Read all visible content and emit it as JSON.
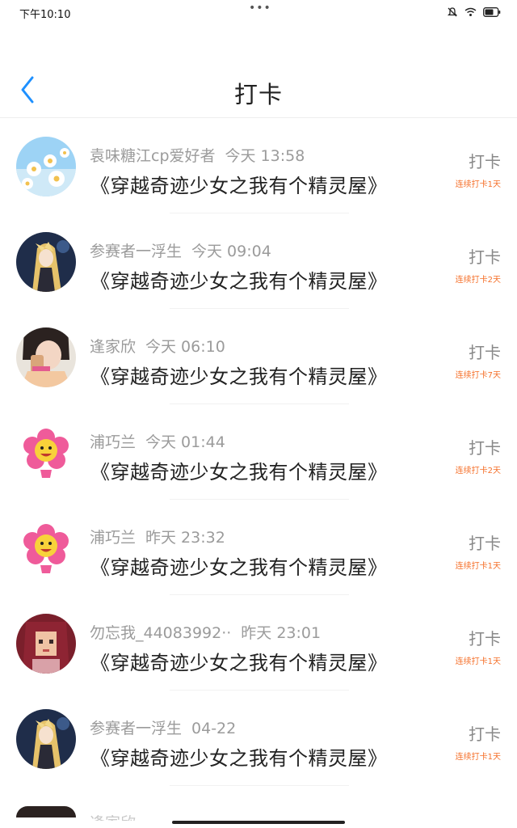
{
  "status_bar": {
    "time": "下午10:10",
    "dots": "•••",
    "icons": [
      "mute-icon",
      "wifi-icon",
      "battery-icon"
    ]
  },
  "header": {
    "title": "打卡",
    "back_icon": "chevron-left-icon",
    "accent_color": "#1e90ff"
  },
  "checkins": [
    {
      "user": "袁味糖江cp爱好者",
      "time": "今天 13:58",
      "book": "《穿越奇迹少女之我有个精灵屋》",
      "action": "打卡",
      "streak": "连续打卡1天",
      "avatar": "flowers-avatar"
    },
    {
      "user": "参赛者一浮生",
      "time": "今天 09:04",
      "book": "《穿越奇迹少女之我有个精灵屋》",
      "action": "打卡",
      "streak": "连续打卡2天",
      "avatar": "anime-girl-avatar"
    },
    {
      "user": "逢家欣",
      "time": "今天 06:10",
      "book": "《穿越奇迹少女之我有个精灵屋》",
      "action": "打卡",
      "streak": "连续打卡7天",
      "avatar": "photo-girl-avatar"
    },
    {
      "user": "浦巧兰",
      "time": "今天 01:44",
      "book": "《穿越奇迹少女之我有个精灵屋》",
      "action": "打卡",
      "streak": "连续打卡2天",
      "avatar": "flower-cartoon-avatar"
    },
    {
      "user": "浦巧兰",
      "time": "昨天 23:32",
      "book": "《穿越奇迹少女之我有个精灵屋》",
      "action": "打卡",
      "streak": "连续打卡1天",
      "avatar": "flower-cartoon-avatar"
    },
    {
      "user": "勿忘我_44083992··",
      "time": "昨天 23:01",
      "book": "《穿越奇迹少女之我有个精灵屋》",
      "action": "打卡",
      "streak": "连续打卡1天",
      "avatar": "pixel-girl-avatar"
    },
    {
      "user": "参赛者一浮生",
      "time": "04-22",
      "book": "《穿越奇迹少女之我有个精灵屋》",
      "action": "打卡",
      "streak": "连续打卡1天",
      "avatar": "anime-girl-avatar"
    }
  ],
  "partial_row": {
    "user": "逢家欣"
  },
  "colors": {
    "streak": "#f5702a",
    "meta": "#9b9b9b",
    "book": "#222222"
  }
}
